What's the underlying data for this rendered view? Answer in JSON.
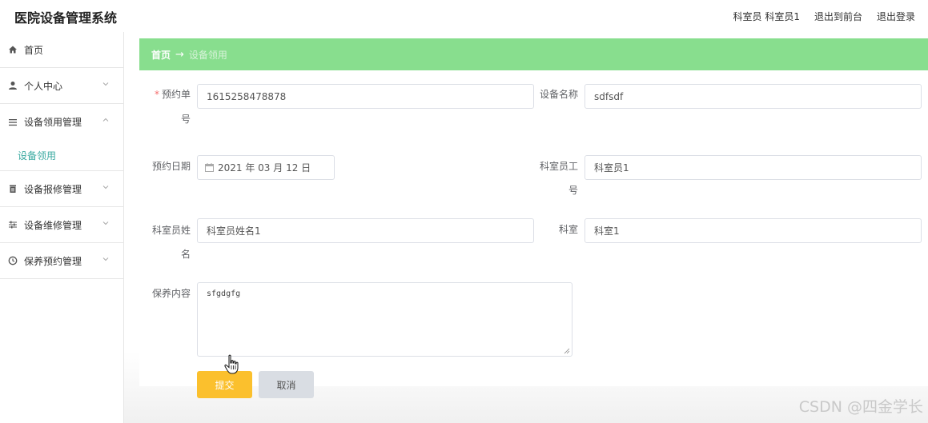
{
  "header": {
    "app_title": "医院设备管理系统",
    "user_info": "科室员 科室员1",
    "goto_front": "退出到前台",
    "logout": "退出登录"
  },
  "sidebar": {
    "items": [
      {
        "label": "首页",
        "icon": "home-icon"
      },
      {
        "label": "个人中心",
        "icon": "user-icon"
      },
      {
        "label": "设备领用管理",
        "icon": "list-icon",
        "expanded": true,
        "children": [
          "设备领用"
        ]
      },
      {
        "label": "设备报修管理",
        "icon": "trash-icon"
      },
      {
        "label": "设备维修管理",
        "icon": "sliders-icon"
      },
      {
        "label": "保养预约管理",
        "icon": "clock-icon"
      }
    ]
  },
  "breadcrumb": {
    "home": "首页",
    "arrow": "→",
    "current": "设备领用"
  },
  "form": {
    "order_no_label": "预约单号",
    "order_no_value": "1615258478878",
    "device_name_label": "设备名称",
    "device_name_value": "sdfsdf",
    "date_label": "预约日期",
    "date_value": "2021 年 03 月 12 日",
    "staff_no_label_1": "科室员工",
    "staff_no_label_2": "号",
    "staff_no_value": "科室员1",
    "staff_name_label_1": "科室员姓",
    "staff_name_label_2": "名",
    "staff_name_value": "科室员姓名1",
    "dept_label": "科室",
    "dept_value": "科室1",
    "content_label": "保养内容",
    "content_value": "sfgdgfg",
    "submit": "提交",
    "cancel": "取消"
  },
  "colors": {
    "breadcrumb_bg": "#88de8e",
    "accent_teal": "#39a9a0",
    "submit_bg": "#fbc02d",
    "required": "#f56c6c"
  },
  "watermark": "CSDN @四金学长"
}
